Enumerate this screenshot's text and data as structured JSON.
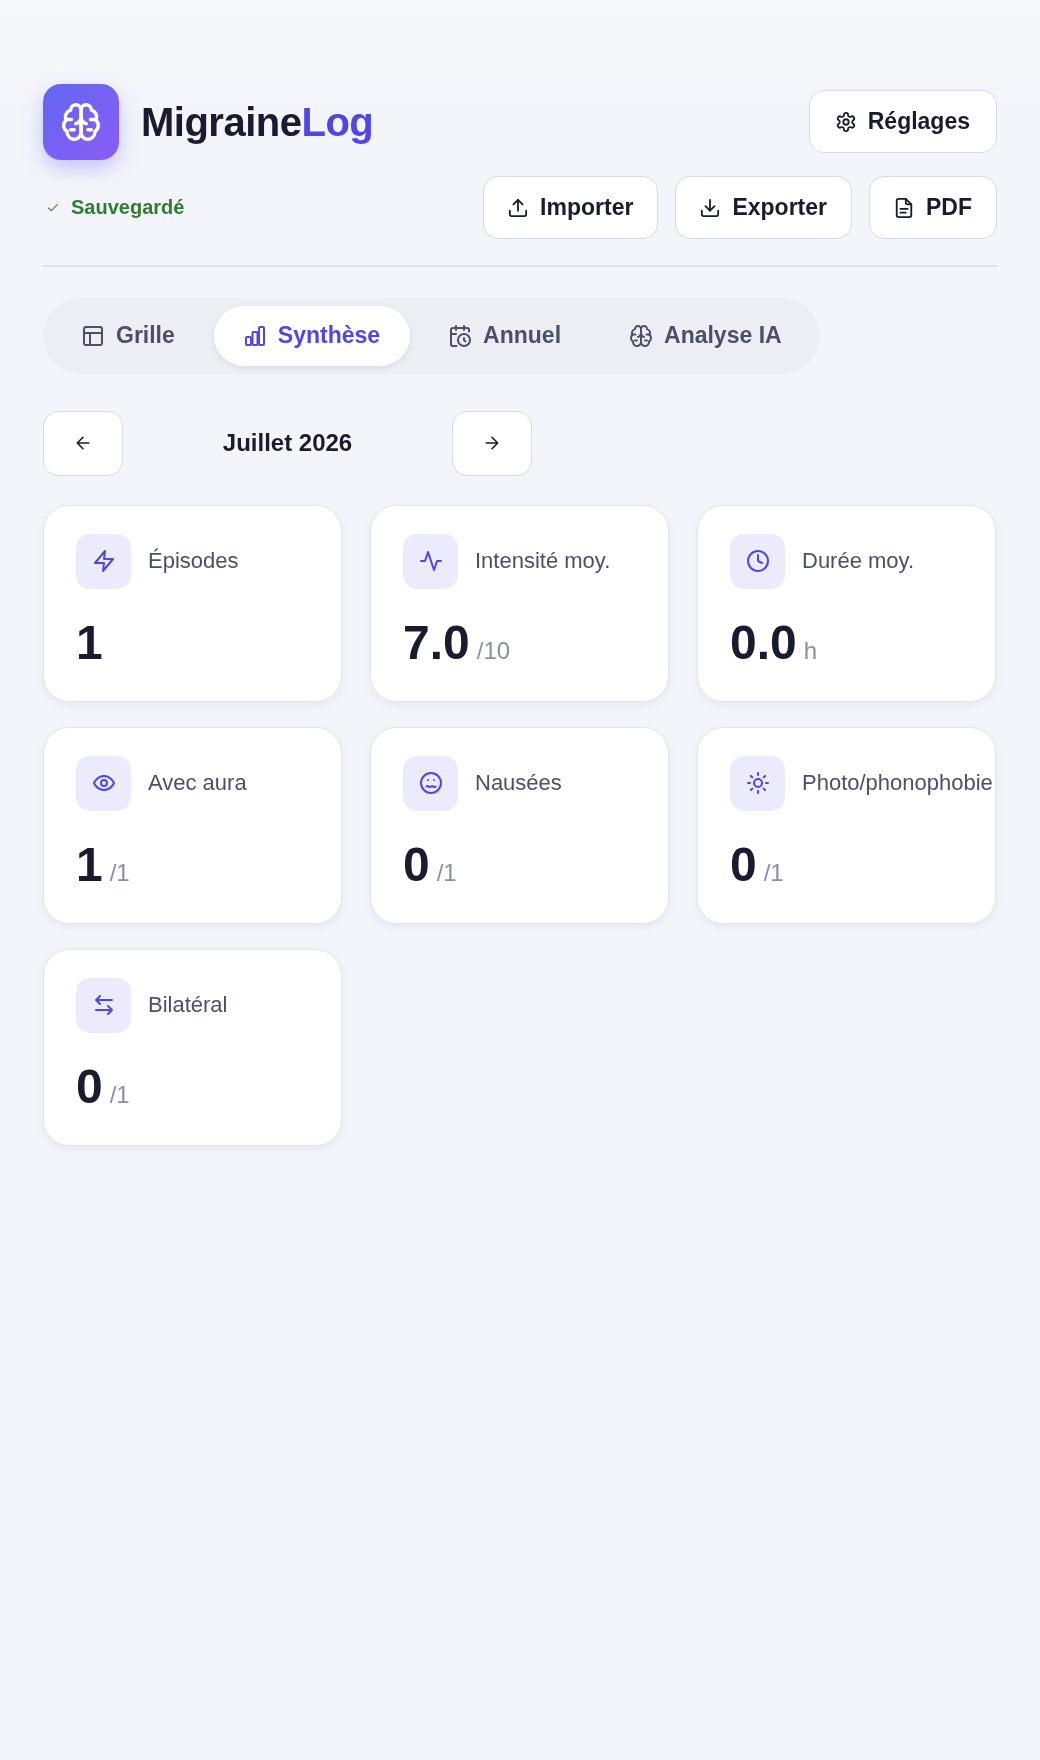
{
  "header": {
    "app_name": "Migraine",
    "app_name_accent": "Log",
    "save_status": "Sauvegardé",
    "settings_button": "Réglages",
    "actions": [
      {
        "kind": "import",
        "label": "Importer"
      },
      {
        "kind": "export",
        "label": "Exporter"
      },
      {
        "kind": "pdf",
        "label": "PDF"
      }
    ]
  },
  "tabs": [
    {
      "kind": "grid",
      "label": "Grille",
      "selected": false
    },
    {
      "kind": "chart",
      "label": "Synthèse",
      "selected": true
    },
    {
      "kind": "calendar",
      "label": "Annuel",
      "selected": false
    },
    {
      "kind": "brain",
      "label": "Analyse IA",
      "selected": false
    }
  ],
  "month_nav": {
    "label": "Juillet 2026"
  },
  "stats": [
    {
      "kind": "bolt",
      "label": "Épisodes",
      "value": "1"
    },
    {
      "kind": "pulse",
      "label": "Intensité moy.",
      "value": "7.0",
      "unit": "/10"
    },
    {
      "kind": "clock",
      "label": "Durée moy.",
      "value": "0.0",
      "unit": "h"
    },
    {
      "kind": "eye",
      "label": "Avec aura",
      "value": "1",
      "unit": "/1"
    },
    {
      "kind": "nausea",
      "label": "Nausées",
      "value": "0",
      "unit": "/1"
    },
    {
      "kind": "sun",
      "label": "Photo/phonophobie",
      "value": "0",
      "unit": "/1"
    },
    {
      "kind": "arrows",
      "label": "Bilatéral",
      "value": "0",
      "unit": "/1"
    }
  ]
}
